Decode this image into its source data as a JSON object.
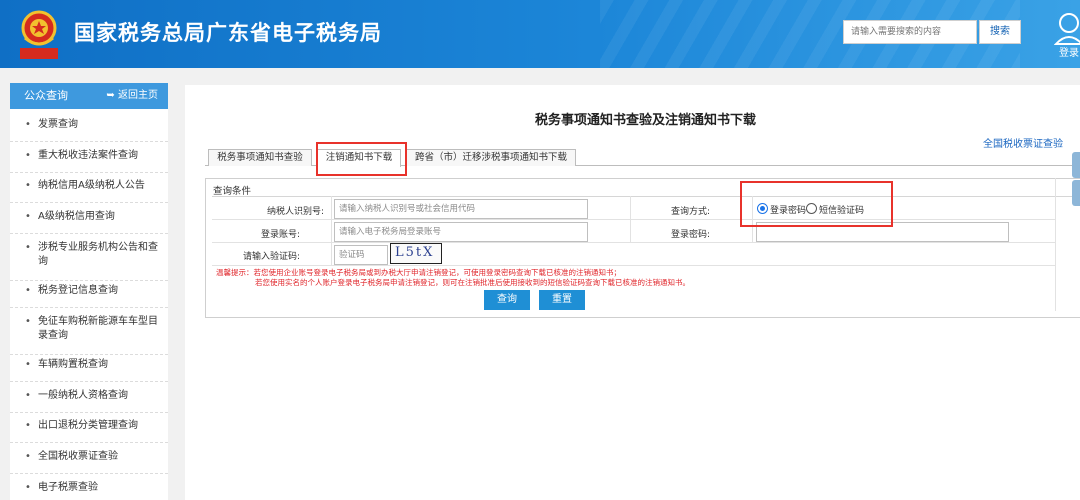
{
  "header": {
    "emblem_seal_text": "中国税务",
    "site_title": "国家税务总局广东省电子税务局",
    "search_placeholder": "请输入需要搜索的内容",
    "search_button": "搜索",
    "login_label": "登录",
    "colors": {
      "header_blue": "#1c86d8",
      "emblem_red": "#d52b1e",
      "emblem_gold": "#f2c12e"
    }
  },
  "sidebar": {
    "title": "公众查询",
    "back_home": "返回主页",
    "back_icon": "return-arrow-icon",
    "items": [
      {
        "label": "发票查询"
      },
      {
        "label": "重大税收违法案件查询"
      },
      {
        "label": "纳税信用A级纳税人公告"
      },
      {
        "label": "A级纳税信用查询"
      },
      {
        "label": "涉税专业服务机构公告和查询"
      },
      {
        "label": "税务登记信息查询"
      },
      {
        "label": "免征车购税新能源车车型目录查询"
      },
      {
        "label": "车辆购置税查询"
      },
      {
        "label": "一般纳税人资格查询"
      },
      {
        "label": "出口退税分类管理查询"
      },
      {
        "label": "全国税收票证查验"
      },
      {
        "label": "电子税票查验"
      }
    ]
  },
  "main": {
    "page_title": "税务事项通知书查验及注销通知书下载",
    "top_right_link": "全国税收票证查验",
    "tabs": [
      {
        "label": "税务事项通知书查验",
        "active": false
      },
      {
        "label": "注销通知书下载",
        "active": true
      },
      {
        "label": "跨省（市）迁移涉税事项通知书下载",
        "active": false
      }
    ],
    "form": {
      "caption": "查询条件",
      "taxpayer_id_label": "纳税人识别号:",
      "taxpayer_id_placeholder": "请输入纳税人识别号或社会信用代码",
      "account_label": "登录账号:",
      "account_placeholder": "请输入电子税务局登录账号",
      "captcha_label": "请输入验证码:",
      "captcha_placeholder": "验证码",
      "captcha_text": "L5tX",
      "query_mode_label": "查询方式:",
      "query_mode_options": [
        "登录密码",
        "短信验证码"
      ],
      "query_mode_selected": "登录密码",
      "password_label": "登录密码:",
      "tip_line1": "温馨提示：若您使用企业账号登录电子税务局或到办税大厅申请注销登记，可使用登录密码查询下载已核准的注销通知书；",
      "tip_line2": "若您使用实名的个人账户登录电子税务局申请注销登记，则可在注销批准后使用接收到的短信验证码查询下载已核准的注销通知书。",
      "query_button": "查询",
      "reset_button": "重置"
    },
    "highlight_color": "#e8322b"
  }
}
